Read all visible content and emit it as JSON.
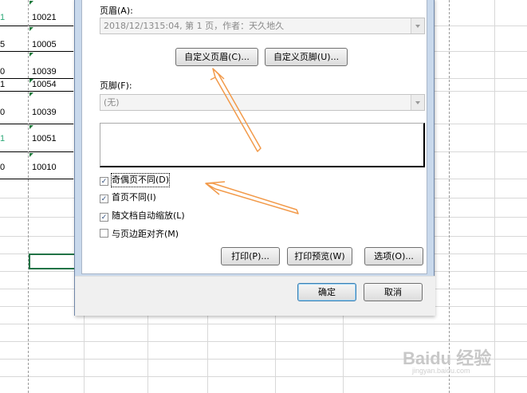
{
  "spreadsheet": {
    "rows": [
      {
        "frag": "1",
        "value": "10021",
        "frag_color": "#2aa876"
      },
      {
        "frag": "5",
        "value": "10005",
        "frag_color": "#000000"
      },
      {
        "frag": "0",
        "value": "10039",
        "frag_color": "#000000"
      },
      {
        "frag": "1",
        "value": "10054",
        "frag_color": "#000000"
      },
      {
        "frag": "0",
        "value": "10039",
        "frag_color": "#000000"
      },
      {
        "frag": "1",
        "value": "10051",
        "frag_color": "#2aa876"
      },
      {
        "frag": "0",
        "value": "10010",
        "frag_color": "#000000"
      }
    ]
  },
  "dialog": {
    "header_label": "页眉(A):",
    "header_value": "2018/12/1315:04,  第 1 页，作者：天久地久",
    "custom_header_button": "自定义页眉(C)...",
    "custom_footer_button": "自定义页脚(U)...",
    "footer_label": "页脚(F):",
    "footer_value": "(无)",
    "options": [
      {
        "label": "奇偶页不同(D)",
        "checked": true
      },
      {
        "label": "首页不同(I)",
        "checked": true
      },
      {
        "label": "随文档自动缩放(L)",
        "checked": true
      },
      {
        "label": "与页边距对齐(M)",
        "checked": false
      }
    ],
    "print_button": "打印(P)...",
    "print_preview_button": "打印预览(W)",
    "options_button": "选项(O)...",
    "ok_button": "确定",
    "cancel_button": "取消"
  },
  "watermark": {
    "text": "Baidu 经验",
    "sub": "jingyan.baidu.com"
  },
  "colors": {
    "annotation_arrow": "#f29a4a",
    "selection": "#217346"
  }
}
